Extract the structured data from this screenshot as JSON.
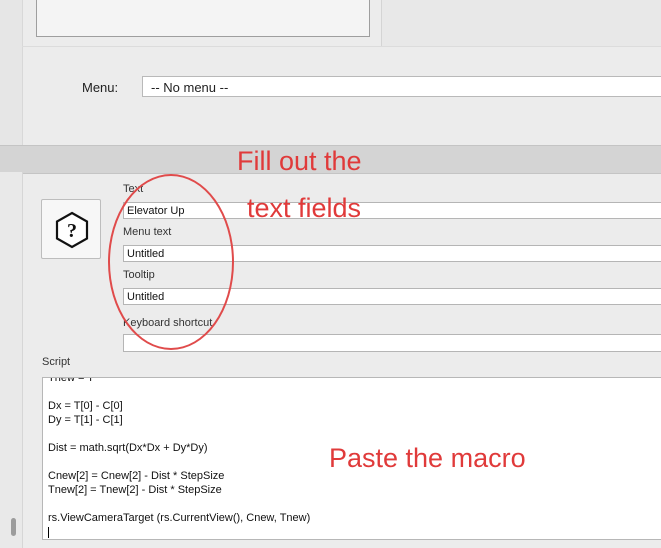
{
  "menu": {
    "label": "Menu:",
    "value": "-- No menu --"
  },
  "icon": {
    "name": "question-hexagon-icon"
  },
  "fields": {
    "text": {
      "label": "Text",
      "value": "Elevator Up"
    },
    "menu_text": {
      "label": "Menu text",
      "value": "Untitled"
    },
    "tooltip": {
      "label": "Tooltip",
      "value": "Untitled"
    },
    "shortcut": {
      "label": "Keyboard shortcut",
      "value": ""
    }
  },
  "script": {
    "label": "Script",
    "lines": [
      "Tnew = T",
      "",
      "Dx = T[0] - C[0]",
      "Dy = T[1] - C[1]",
      "",
      "Dist = math.sqrt(Dx*Dx + Dy*Dy)",
      "",
      "Cnew[2] = Cnew[2] - Dist * StepSize",
      "Tnew[2] = Tnew[2] - Dist * StepSize",
      "",
      "rs.ViewCameraTarget (rs.CurrentView(), Cnew, Tnew)"
    ]
  },
  "annotations": {
    "fill_line1": "Fill out the",
    "fill_line2": "text fields",
    "paste": "Paste the macro",
    "color": "#e03a3a"
  }
}
